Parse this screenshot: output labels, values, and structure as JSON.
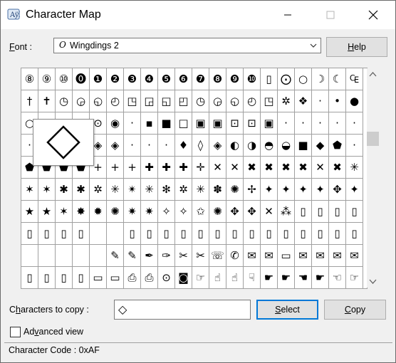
{
  "window": {
    "title": "Character Map",
    "icon": "character-map-app-icon"
  },
  "font_row": {
    "label": "Font :",
    "selected_font": "Wingdings 2",
    "font_type_icon": "opentype-font-icon",
    "help_button": "Help"
  },
  "grid": {
    "columns": 20,
    "rows": 10,
    "cells": [
      "⑧",
      "⑨",
      "⑩",
      "⓿",
      "❶",
      "❷",
      "❸",
      "❹",
      "❺",
      "❻",
      "❼",
      "❽",
      "❾",
      "❿",
      "▯",
      "⨀",
      "○",
      "☽",
      "☾",
      "₠",
      "†",
      "✝",
      "◷",
      "◶",
      "◵",
      "◴",
      "◳",
      "◲",
      "◱",
      "◰",
      "◷",
      "◶",
      "◵",
      "◴",
      "◳",
      "✲",
      "❖",
      "·",
      "•",
      "●",
      "○",
      "◎",
      "◉",
      "◉",
      "⊙",
      "◉",
      "·",
      "▪",
      "■",
      "□",
      "▣",
      "▣",
      "⊡",
      "⊡",
      "▣",
      "·",
      "·",
      "·",
      "·",
      "·",
      "·",
      "·",
      "·",
      "·",
      "◈",
      "◈",
      "·",
      "·",
      "·",
      "♦",
      "◊",
      "◈",
      "◐",
      "◑",
      "◓",
      "◒",
      "■",
      "◆",
      "⬟",
      "·",
      "⬟",
      "⬟",
      "⬟",
      "⬟",
      "+",
      "+",
      "+",
      "✚",
      "✚",
      "✚",
      "✛",
      "✕",
      "✕",
      "✖",
      "✖",
      "✖",
      "✖",
      "✕",
      "✖",
      "✳",
      "✶",
      "✶",
      "✱",
      "✱",
      "✲",
      "✳",
      "✴",
      "✳",
      "✻",
      "✲",
      "✳",
      "✽",
      "✺",
      "✢",
      "✦",
      "✦",
      "✦",
      "✦",
      "✥",
      "✦",
      "★",
      "★",
      "✶",
      "✸",
      "✹",
      "✺",
      "✷",
      "✷",
      "✧",
      "✧",
      "✩",
      "✺",
      "✥",
      "✥",
      "✕",
      "⁂",
      "▯",
      "▯",
      "▯",
      "▯",
      "▯",
      "▯",
      "▯",
      "▯",
      "",
      "",
      "▯",
      "▯",
      "▯",
      "▯",
      "▯",
      "▯",
      "▯",
      "▯",
      "▯",
      "▯",
      "▯",
      "▯",
      "▯",
      "▯",
      "",
      "",
      "",
      "",
      "",
      "✎",
      "✎",
      "✒",
      "✑",
      "✂",
      "✂",
      "☏",
      "✆",
      "✉",
      "✉",
      "▭",
      "✉",
      "✉",
      "✉",
      "✉",
      "▯",
      "▯",
      "▯",
      "▯",
      "▭",
      "▭",
      "⎙",
      "⎙",
      "⊙",
      "◙",
      "☞",
      "☝",
      "☝",
      "☟",
      "☛",
      "☛",
      "☚",
      "☛",
      "☜",
      "☞"
    ],
    "zoomed_char": "diamond-outline",
    "selected_index": 60
  },
  "copy_row": {
    "label": "Characters to copy :",
    "value_glyph": "◇",
    "select_button": "Select",
    "copy_button": "Copy"
  },
  "advanced": {
    "label": "Advanced view",
    "checked": false
  },
  "status": {
    "text": "Character Code : 0xAF"
  }
}
